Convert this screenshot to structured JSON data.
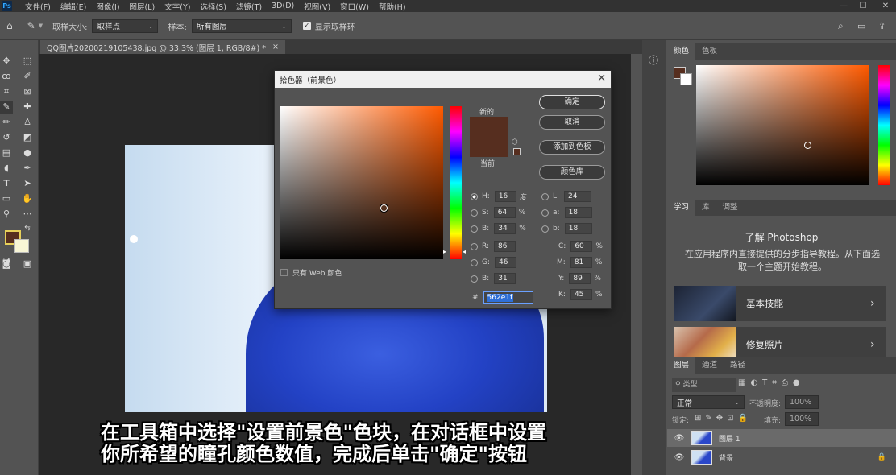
{
  "menubar": {
    "logo": "Ps",
    "items": [
      "文件(F)",
      "编辑(E)",
      "图像(I)",
      "图层(L)",
      "文字(Y)",
      "选择(S)",
      "滤镜(T)",
      "3D(D)",
      "视图(V)",
      "窗口(W)",
      "帮助(H)"
    ],
    "controls": [
      "minimize",
      "maximize",
      "close"
    ]
  },
  "options": {
    "sample_size_label": "取样大小:",
    "sample_size_value": "取样点",
    "sample_label": "样本:",
    "sample_value": "所有图层",
    "show_ring_label": "显示取样环",
    "show_ring_checked": true
  },
  "document": {
    "tab_title": "QQ图片20200219105438.jpg @ 33.3% (图层 1, RGB/8#) *",
    "close": "×"
  },
  "dialog": {
    "title": "拾色器（前景色）",
    "new_label": "新的",
    "current_label": "当前",
    "new_color": "#562e1f",
    "current_color": "#562e1f",
    "hue_color": "#ff5a00",
    "buttons": {
      "ok": "确定",
      "cancel": "取消",
      "add_swatch": "添加到色板",
      "library": "颜色库"
    },
    "web_only_label": "只有 Web 颜色",
    "fields": {
      "H": {
        "label": "H:",
        "value": "16",
        "unit": "度"
      },
      "S": {
        "label": "S:",
        "value": "64",
        "unit": "%"
      },
      "B": {
        "label": "B:",
        "value": "34",
        "unit": "%"
      },
      "R": {
        "label": "R:",
        "value": "86"
      },
      "G": {
        "label": "G:",
        "value": "46"
      },
      "Bl": {
        "label": "B:",
        "value": "31"
      },
      "L": {
        "label": "L:",
        "value": "24"
      },
      "a": {
        "label": "a:",
        "value": "18"
      },
      "b": {
        "label": "b:",
        "value": "18"
      },
      "C": {
        "label": "C:",
        "value": "60",
        "unit": "%"
      },
      "M": {
        "label": "M:",
        "value": "81",
        "unit": "%"
      },
      "Y": {
        "label": "Y:",
        "value": "89",
        "unit": "%"
      },
      "K": {
        "label": "K:",
        "value": "45",
        "unit": "%"
      },
      "hex_label": "#",
      "hex": "562e1f"
    }
  },
  "color_panel": {
    "tabs": [
      "颜色",
      "色板"
    ],
    "fg": "#562e1f",
    "bg": "#ffffff"
  },
  "learn_panel": {
    "tabs": [
      "学习",
      "库",
      "调整"
    ],
    "title": "了解 Photoshop",
    "desc": "在应用程序内直接提供的分步指导教程。从下面选取一个主题开始教程。",
    "cards": [
      {
        "label": "基本技能"
      },
      {
        "label": "修复照片"
      }
    ]
  },
  "layers_panel": {
    "tabs": [
      "图层",
      "通道",
      "路径"
    ],
    "kind_label": "类型",
    "blend_mode": "正常",
    "opacity_label": "不透明度:",
    "opacity": "100%",
    "lock_label": "锁定:",
    "fill_label": "填充:",
    "fill": "100%",
    "layers": [
      {
        "name": "图层 1",
        "selected": true
      },
      {
        "name": "背景",
        "locked": true
      }
    ]
  },
  "subtitle": {
    "line1": "在工具箱中选择\"设置前景色\"色块，在对话框中设置",
    "line2": "你所希望的瞳孔颜色数值，完成后单击\"确定\"按钮"
  }
}
